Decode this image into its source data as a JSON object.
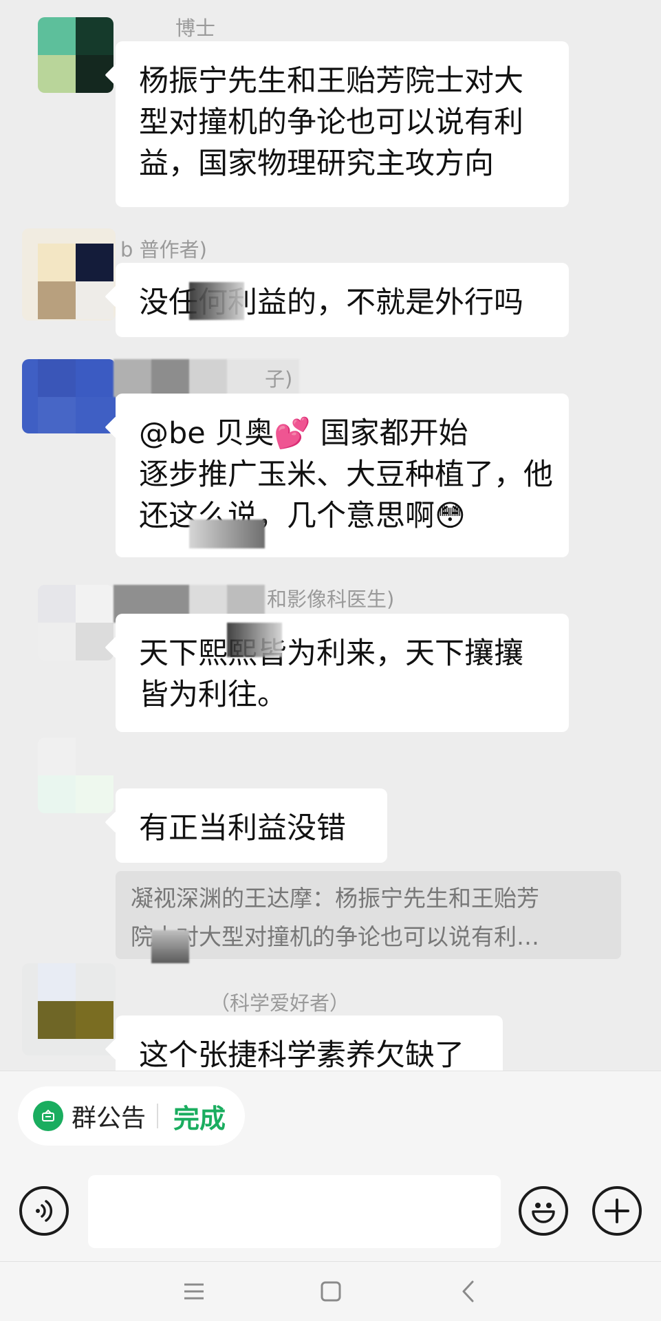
{
  "messages": [
    {
      "sender": "博士",
      "lines": [
        "杨振宁先生和王贻芳院士对大",
        "型对撞机的争论也可以说有利",
        "益，国家物理研究主攻方向"
      ]
    },
    {
      "sender": "b 普作者)",
      "lines": [
        "没任何利益的，不就是外行吗"
      ]
    },
    {
      "sender": "子)",
      "lines": [
        "@be 贝奥💕  国家都开始",
        "逐步推广玉米、大豆种植了，他",
        "还这么说，几个意思啊😳"
      ]
    },
    {
      "sender": "和影像科医生)",
      "lines": [
        "天下熙熙皆为利来，天下攘攘",
        "皆为利往。"
      ]
    },
    {
      "sender": "",
      "lines": [
        "有正当利益没错"
      ],
      "quote": [
        "凝视深渊的王达摩：杨振宁先生和王贻芳",
        "院士对大型对撞机的争论也可以说有利…"
      ]
    },
    {
      "sender": "（科学爱好者）",
      "lines": [
        "这个张捷科学素养欠缺了"
      ]
    }
  ],
  "notice": {
    "label": "群公告",
    "done": "完成"
  },
  "input": {
    "placeholder": ""
  },
  "icons": {
    "voice": "voice-icon",
    "emoji": "emoji-icon",
    "plus": "plus-icon",
    "notice": "notice-icon",
    "menu": "menu-icon",
    "home": "home-icon",
    "back": "back-icon"
  },
  "colors": {
    "accent": "#1aad5f",
    "background": "#ededed",
    "bubble": "#ffffff"
  }
}
